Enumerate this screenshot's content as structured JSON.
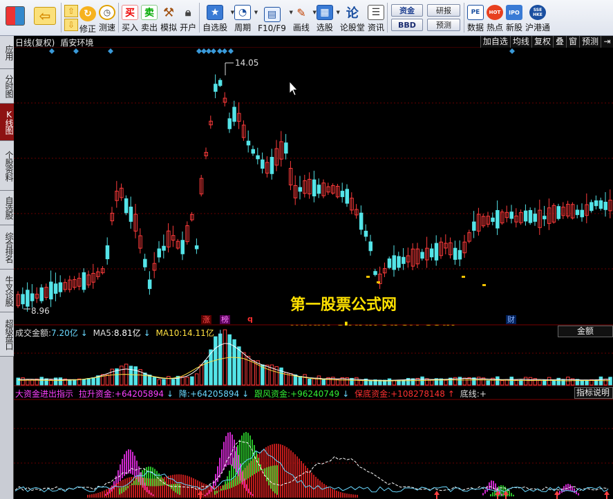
{
  "toolbar": {
    "layout_btn": "",
    "back_btn": "",
    "modify_label": "修正",
    "speed_label": "测速",
    "buy_label": "买入",
    "buy_glyph": "买",
    "sell_label": "卖出",
    "sell_glyph": "卖",
    "sim_label": "模拟",
    "open_label": "开户",
    "watch_label": "自选股",
    "period_label": "周期",
    "f10_label": "F10/F9",
    "draw_label": "画线",
    "pick_label": "选股",
    "forum_label": "论股堂",
    "forum_glyph": "论",
    "info_label": "资讯",
    "fund_pill": "资金",
    "bbd_pill": "BBD",
    "research_pill": "研报",
    "forecast_pill": "预测",
    "data_label": "数据",
    "hot_label": "热点",
    "new_label": "新股",
    "hk_label": "沪港通",
    "pe_glyph": "PE",
    "ipo_glyph": "IPO",
    "hot_glyph": "HOT",
    "sse_glyph": "SSE HKE"
  },
  "side_tabs": [
    "应用",
    "分时图",
    "K线图",
    "个股资料",
    "自选股",
    "综合排名",
    "牛叉诊股",
    "超级盘口"
  ],
  "chart": {
    "mode": "日线(复权)",
    "name": "盾安环境",
    "buttons": [
      "加自选",
      "均线",
      "复权",
      "叠",
      "窗",
      "预测"
    ],
    "exit_icon": "exit-icon",
    "high_label": "14.05",
    "low_label": "8.96",
    "badges": {
      "zhang": "涨",
      "bang": "榜",
      "q": "q",
      "cai": "财"
    }
  },
  "volume": {
    "title": "成交金额:",
    "value": "7.20亿",
    "ma5_label": "MA5:",
    "ma5": "8.81亿",
    "ma10_label": "MA10:",
    "ma10": "14.11亿",
    "button": "金额"
  },
  "indicator": {
    "name": "大资金进出指示",
    "raise_label": "拉升资金:",
    "raise": "+64205894",
    "drop_label": "降:",
    "drop": "+64205894",
    "follow_label": "跟风资金:",
    "follow": "+96240749",
    "guard_label": "保底资金:",
    "guard": "+108278148",
    "bottom_label": "底线:",
    "bottom": "+",
    "button": "指标说明"
  },
  "watermark": {
    "cn": "第一股票公式网",
    "url": "www.chnmoney.com"
  },
  "colors": {
    "up": "#ff3b3b",
    "down": "#54e4e8",
    "magenta": "#ff33ff",
    "green": "#33ee33",
    "red": "#ee2222",
    "yellow": "#ffe100",
    "grid": "#6a0000",
    "diamond": "#3a9ad9"
  }
}
